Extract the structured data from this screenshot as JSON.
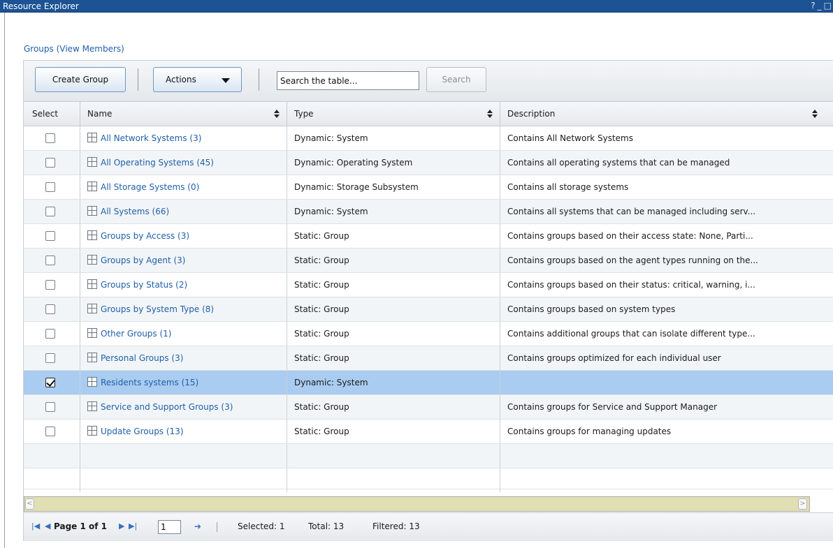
{
  "window": {
    "title": "Resource Explorer",
    "controls": [
      "?",
      "_",
      "□"
    ]
  },
  "breadcrumb_link": "Groups (View Members)",
  "toolbar": {
    "create_label": "Create Group",
    "actions_label": "Actions",
    "search_value": "Search the table...",
    "search_button": "Search"
  },
  "table": {
    "columns": {
      "select": "Select",
      "name": "Name",
      "type": "Type",
      "description": "Description"
    },
    "rows": [
      {
        "name": "All Network Systems (3)",
        "type": "Dynamic: System",
        "description": "Contains All Network Systems",
        "checked": false
      },
      {
        "name": "All Operating Systems (45)",
        "type": "Dynamic: Operating System",
        "description": "Contains all operating systems that can be managed",
        "checked": false
      },
      {
        "name": "All Storage Systems (0)",
        "type": "Dynamic: Storage Subsystem",
        "description": "Contains all storage systems",
        "checked": false
      },
      {
        "name": "All Systems (66)",
        "type": "Dynamic: System",
        "description": "Contains all systems that can be managed including serv...",
        "checked": false
      },
      {
        "name": "Groups by Access (3)",
        "type": "Static: Group",
        "description": "Contains groups based on their access state: None, Parti...",
        "checked": false
      },
      {
        "name": "Groups by Agent (3)",
        "type": "Static: Group",
        "description": "Contains groups based on the agent types running on the...",
        "checked": false
      },
      {
        "name": "Groups by Status (2)",
        "type": "Static: Group",
        "description": "Contains groups based on their status: critical, warning, i...",
        "checked": false
      },
      {
        "name": "Groups by System Type (8)",
        "type": "Static: Group",
        "description": "Contains groups based on system types",
        "checked": false
      },
      {
        "name": "Other Groups (1)",
        "type": "Static: Group",
        "description": "Contains additional groups that can isolate different type...",
        "checked": false
      },
      {
        "name": "Personal Groups (3)",
        "type": "Static: Group",
        "description": "Contains groups optimized for each individual user",
        "checked": false
      },
      {
        "name": "Residents systems (15)",
        "type": "Dynamic: System",
        "description": "",
        "checked": true
      },
      {
        "name": "Service and Support Groups (3)",
        "type": "Static: Group",
        "description": "Contains groups for Service and Support Manager",
        "checked": false
      },
      {
        "name": "Update Groups (13)",
        "type": "Static: Group",
        "description": "Contains groups for managing updates",
        "checked": false
      }
    ]
  },
  "footer": {
    "page_label": "Page 1 of 1",
    "page_input": "1",
    "selected": "Selected: 1",
    "total": "Total: 13",
    "filtered": "Filtered: 13"
  },
  "colors": {
    "titlebar": "#1d5393",
    "link": "#1f5fa8",
    "selected_row": "#a9ccf0"
  }
}
